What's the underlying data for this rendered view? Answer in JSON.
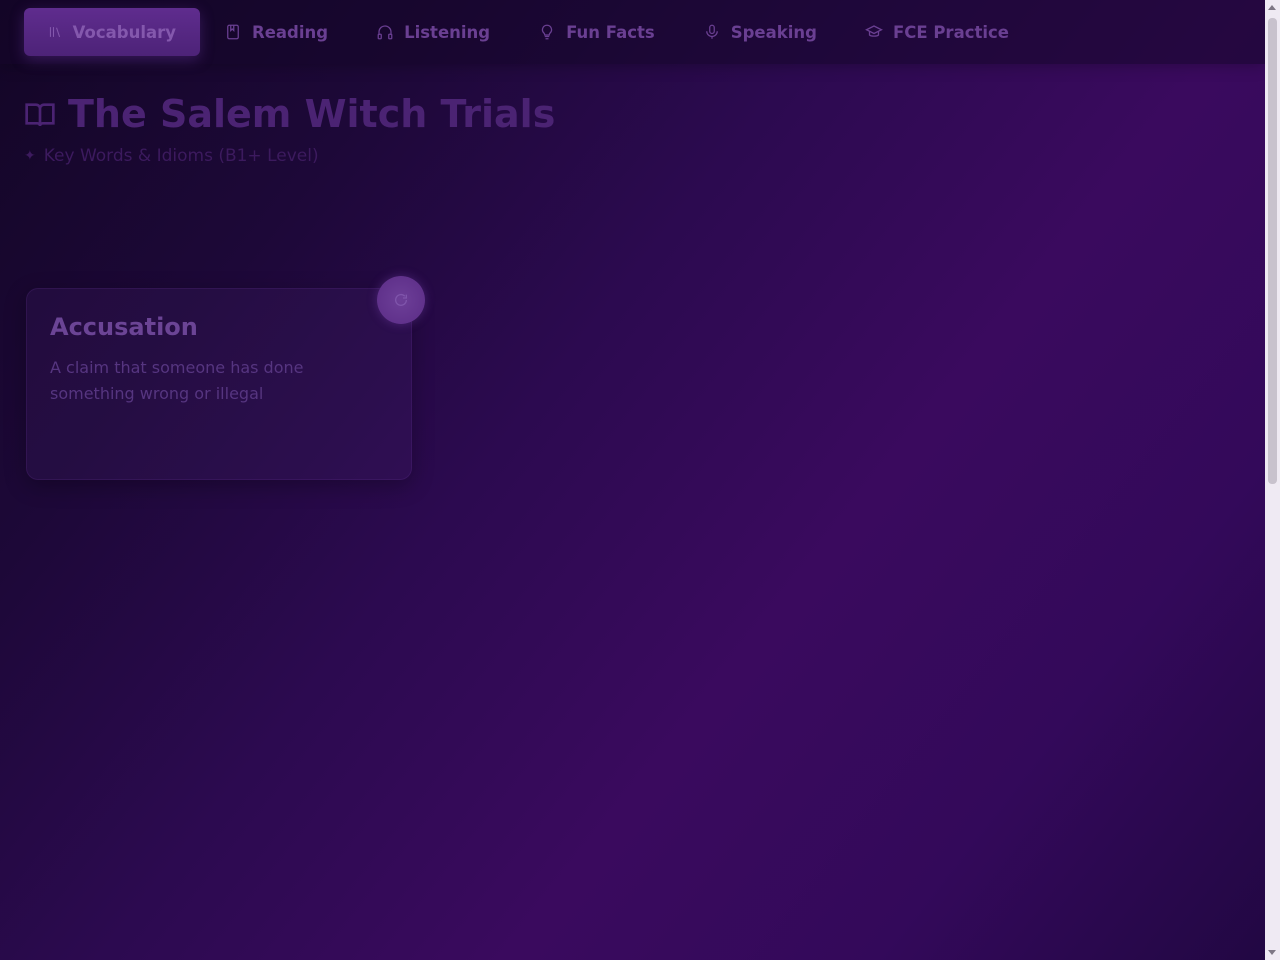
{
  "nav": {
    "tabs": [
      {
        "label": "Vocabulary",
        "icon": "library-icon",
        "active": true
      },
      {
        "label": "Reading",
        "icon": "book-icon",
        "active": false
      },
      {
        "label": "Listening",
        "icon": "headphones-icon",
        "active": false
      },
      {
        "label": "Fun Facts",
        "icon": "lightbulb-icon",
        "active": false
      },
      {
        "label": "Speaking",
        "icon": "microphone-icon",
        "active": false
      },
      {
        "label": "FCE Practice",
        "icon": "graduation-cap-icon",
        "active": false
      }
    ]
  },
  "header": {
    "title": "The Salem Witch Trials",
    "title_icon": "open-book-icon",
    "subtitle": "Key Words & Idioms (B1+ Level)",
    "subtitle_icon": "sparkle-icon"
  },
  "card": {
    "term": "Accusation",
    "definition": "A claim that someone has done something wrong or illegal",
    "flip_icon": "rotate-icon"
  },
  "colors": {
    "background_start": "#130626",
    "background_end": "#3a0a5e",
    "active_tab": "#5f2c8e"
  }
}
